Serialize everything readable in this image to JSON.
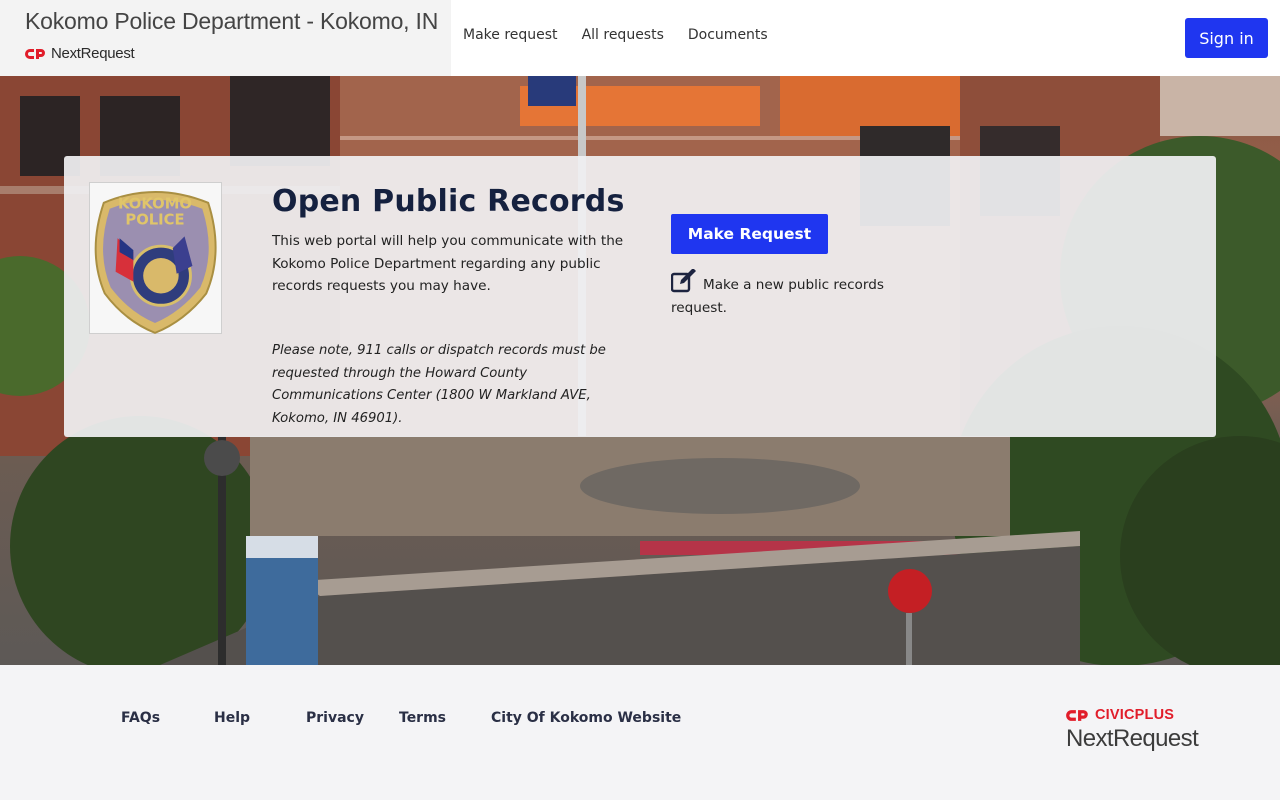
{
  "header": {
    "agency_title": "Kokomo Police Department - Kokomo, IN",
    "logo_text": "NextRequest",
    "nav": [
      "Make request",
      "All requests",
      "Documents"
    ],
    "signin_label": "Sign in"
  },
  "card": {
    "badge": {
      "top": "KOKOMO",
      "bottom": "POLICE",
      "ring": "CITY OF FIRSTS"
    },
    "title": "Open Public Records",
    "description": "This web portal will help you communicate with the Kokomo Police Department regarding any public records requests you may have.",
    "note": "Please note, 911 calls or dispatch records must be requested through the Howard County Communications Center (1800 W Markland AVE, Kokomo, IN 46901).",
    "make_button": "Make Request",
    "make_help": "Make a new public records request."
  },
  "footer": {
    "links": [
      "FAQs",
      "Help",
      "Privacy",
      "Terms",
      "City Of Kokomo Website"
    ],
    "civicplus_label": "CIVICPLUS",
    "nextrequest_label": "NextRequest"
  },
  "colors": {
    "primary": "#1f36f0",
    "title": "#15213f",
    "civicplus_red": "#e11d2a"
  },
  "icons": [
    "nextrequest-logo-icon",
    "edit-icon",
    "civicplus-logo-icon"
  ]
}
